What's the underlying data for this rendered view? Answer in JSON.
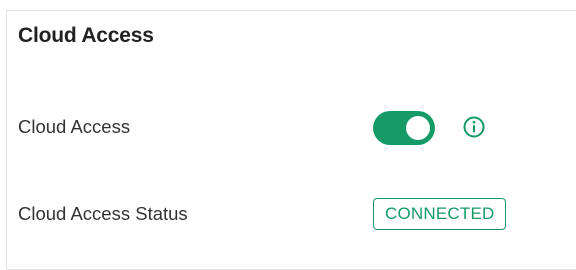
{
  "section": {
    "title": "Cloud Access"
  },
  "rows": {
    "cloud_access": {
      "label": "Cloud Access",
      "toggle_on": true
    },
    "cloud_access_status": {
      "label": "Cloud Access Status",
      "status": "CONNECTED"
    }
  },
  "colors": {
    "accent": "#169b66",
    "border": "#e3e3e3"
  },
  "icons": {
    "info": "info-icon"
  }
}
